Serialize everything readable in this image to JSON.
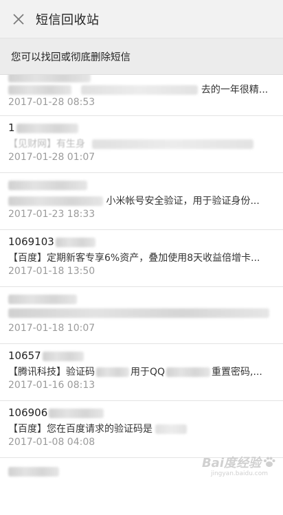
{
  "header": {
    "title": "短信回收站"
  },
  "subheader": {
    "text": "您可以找回或彻底删除短信"
  },
  "messages": [
    {
      "sender": "",
      "preview": "去的一年很精...",
      "time": "2017-01-28 08:53"
    },
    {
      "sender": "1",
      "preview": "【见财网】有生身",
      "time": "2017-01-28 01:07"
    },
    {
      "sender": "",
      "preview": "小米帐号安全验证，用于验证身份...",
      "time": "2017-01-23 18:33"
    },
    {
      "sender": "1069103",
      "preview": "【百度】定期新客专享6%资产，叠加使用8天收益倍增卡...",
      "time": "2017-01-18 13:50"
    },
    {
      "sender": "",
      "preview": "",
      "time": "2017-01-18 10:07"
    },
    {
      "sender": "10657",
      "preview_a": "【腾讯科技】验证码",
      "preview_b": "用于QQ",
      "preview_c": "重置密码,...",
      "time": "2017-01-16 08:13"
    },
    {
      "sender": "106906",
      "preview": "【百度】您在百度请求的验证码是",
      "time": "2017-01-08 04:08"
    }
  ],
  "watermark": {
    "brand": "Bai度经验",
    "url": "jingyan.baidu.com"
  }
}
